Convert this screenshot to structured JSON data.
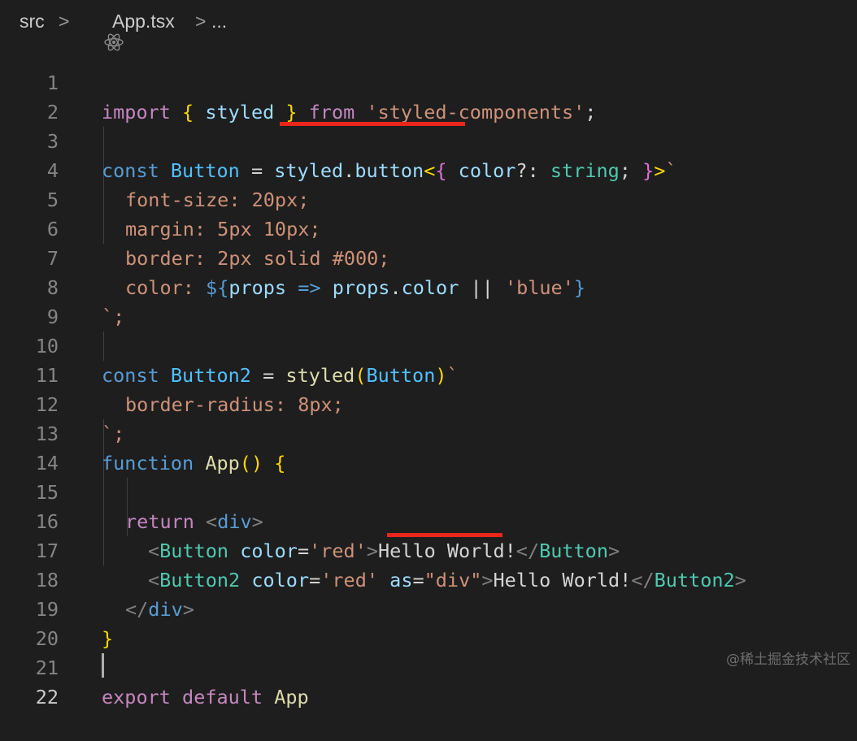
{
  "breadcrumb": {
    "folder": "src",
    "separator": ">",
    "file_icon": "react-icon",
    "file": "App.tsx",
    "ellipsis": "..."
  },
  "editor": {
    "line_numbers": [
      "1",
      "2",
      "3",
      "4",
      "5",
      "6",
      "7",
      "8",
      "9",
      "10",
      "11",
      "12",
      "13",
      "14",
      "15",
      "16",
      "17",
      "18",
      "19",
      "20",
      "21",
      "22"
    ],
    "active_line": "22",
    "code": {
      "l1": {
        "import": "import",
        "brace_open": "{",
        "name": "styled",
        "brace_close": "}",
        "from": "from",
        "module": "'styled-components'",
        "semi": ";"
      },
      "l3": {
        "const": "const",
        "name": "Button",
        "eq": "=",
        "styled": "styled",
        "dot": ".",
        "prop": "button",
        "lt": "<",
        "brace_open": "{",
        "param": "color",
        "opt": "?:",
        "type": "string",
        "semi": ";",
        "brace_close": "}",
        "gt": ">",
        "tick": "`"
      },
      "l4": {
        "text": "font-size: 20px;"
      },
      "l5": {
        "text": "margin: 5px 10px;"
      },
      "l6": {
        "text": "border: 2px solid #000;"
      },
      "l7": {
        "prefix": "color: ",
        "dollar": "${",
        "props": "props",
        "arrow": "=>",
        "props2": "props",
        "dot": ".",
        "color": "color",
        "or": "||",
        "blue": "'blue'",
        "close": "}"
      },
      "l8": {
        "text": "`;"
      },
      "l10": {
        "const": "const",
        "name": "Button2",
        "eq": "=",
        "styled": "styled",
        "paren_open": "(",
        "arg": "Button",
        "paren_close": ")",
        "tick": "`"
      },
      "l11": {
        "text": "border-radius: 8px;"
      },
      "l12": {
        "text": "`;"
      },
      "l13": {
        "function": "function",
        "name": "App",
        "parens": "()",
        "brace": "{"
      },
      "l15": {
        "return": "return",
        "lt": "<",
        "tag": "div",
        "gt": ">"
      },
      "l16": {
        "lt": "<",
        "comp": "Button",
        "attr": "color",
        "eq": "=",
        "val": "'red'",
        "gt": ">",
        "text": "Hello World!",
        "close_lt": "</",
        "close_comp": "Button",
        "close_gt": ">"
      },
      "l17": {
        "lt": "<",
        "comp": "Button2",
        "attr": "color",
        "eq": "=",
        "val": "'red'",
        "attr2": "as",
        "eq2": "=",
        "val2": "\"div\"",
        "gt": ">",
        "text": "Hello World!",
        "close_lt": "</",
        "close_comp": "Button2",
        "close_gt": ">"
      },
      "l18": {
        "lt": "</",
        "tag": "div",
        "gt": ">"
      },
      "l19": {
        "text": "}"
      },
      "l21": {
        "export": "export",
        "default": "default",
        "name": "App"
      }
    }
  },
  "annotation_color": "#e8261a",
  "watermark": "@稀土掘金技术社区"
}
